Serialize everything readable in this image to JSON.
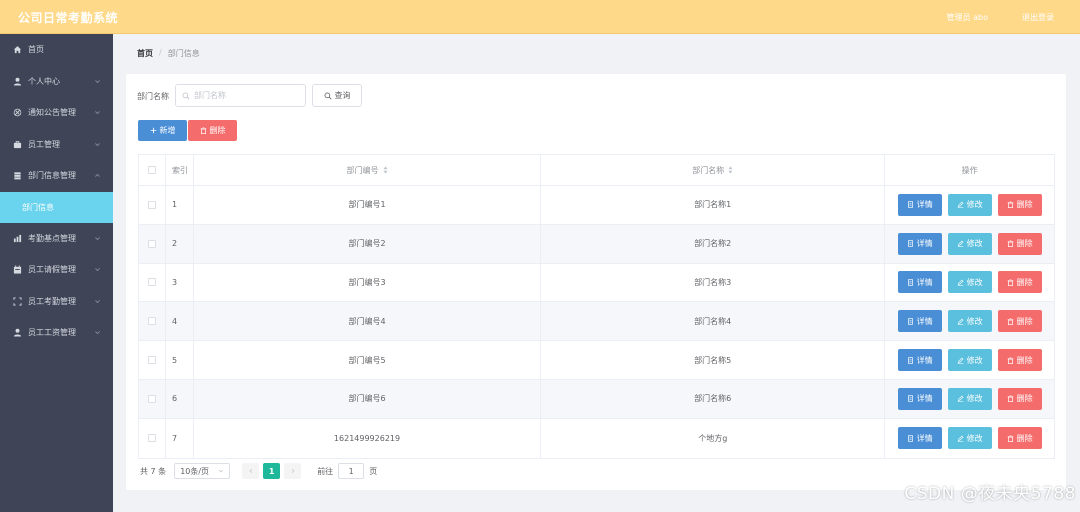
{
  "header": {
    "app_title": "公司日常考勤系统",
    "user_label": "管理员 abo",
    "logout_label": "退出登录",
    "bg_color": "#ffd98a"
  },
  "sidebar": {
    "items": [
      {
        "label": "首页",
        "icon": "home-icon",
        "has_children": false
      },
      {
        "label": "个人中心",
        "icon": "user-icon",
        "has_children": true
      },
      {
        "label": "通知公告管理",
        "icon": "notice-icon",
        "has_children": true
      },
      {
        "label": "员工管理",
        "icon": "briefcase-icon",
        "has_children": true
      },
      {
        "label": "部门信息管理",
        "icon": "database-icon",
        "has_children": true
      },
      {
        "label": "考勤基点管理",
        "icon": "chart-icon",
        "has_children": true
      },
      {
        "label": "员工请假管理",
        "icon": "calendar-icon",
        "has_children": true
      },
      {
        "label": "员工考勤管理",
        "icon": "scan-icon",
        "has_children": true
      },
      {
        "label": "员工工资管理",
        "icon": "user-icon",
        "has_children": true
      }
    ],
    "active_sub": "部门信息",
    "active_color": "#6ad3ed"
  },
  "breadcrumb": {
    "home": "首页",
    "separator": "/",
    "current": "部门信息"
  },
  "search": {
    "label": "部门名称",
    "placeholder": "部门名称",
    "value": "",
    "query_label": "查询"
  },
  "toolbar": {
    "add_label": "新增",
    "delete_label": "删除"
  },
  "table": {
    "headers": {
      "index": "索引",
      "code": "部门编号",
      "name": "部门名称",
      "ops": "操作"
    },
    "op_labels": {
      "detail": "详情",
      "edit": "修改",
      "delete": "删除"
    },
    "rows": [
      {
        "index": "1",
        "code": "部门编号1",
        "name": "部门名称1"
      },
      {
        "index": "2",
        "code": "部门编号2",
        "name": "部门名称2"
      },
      {
        "index": "3",
        "code": "部门编号3",
        "name": "部门名称3"
      },
      {
        "index": "4",
        "code": "部门编号4",
        "name": "部门名称4"
      },
      {
        "index": "5",
        "code": "部门编号5",
        "name": "部门名称5"
      },
      {
        "index": "6",
        "code": "部门编号6",
        "name": "部门名称6"
      },
      {
        "index": "7",
        "code": "1621499926219",
        "name": "个地方g"
      }
    ]
  },
  "pagination": {
    "total": "共 7 条",
    "page_size": "10条/页",
    "current_page": "1",
    "goto_label": "前往",
    "goto_value": "1",
    "page_suffix": "页"
  },
  "watermark": "CSDN @夜未央5788"
}
